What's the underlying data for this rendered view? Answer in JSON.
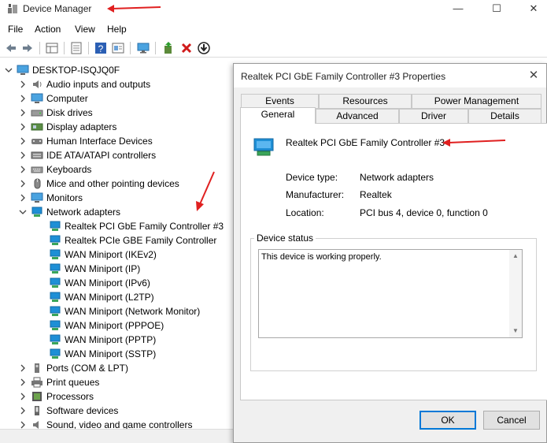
{
  "window": {
    "title": "Device Manager",
    "controls": {
      "minimize": "—",
      "maximize": "☐",
      "close": "✕"
    }
  },
  "menu": [
    "File",
    "Action",
    "View",
    "Help"
  ],
  "toolbar_icons": [
    "back-icon",
    "forward-icon",
    "properties-grid-icon",
    "show-hidden-icon",
    "help-icon",
    "view-icon",
    "monitor-icon",
    "update-driver-icon",
    "uninstall-icon",
    "download-icon"
  ],
  "tree": {
    "root": "DESKTOP-ISQJQ0F",
    "categories": [
      {
        "label": "Audio inputs and outputs",
        "icon": "audio-icon"
      },
      {
        "label": "Computer",
        "icon": "computer-icon"
      },
      {
        "label": "Disk drives",
        "icon": "disk-icon"
      },
      {
        "label": "Display adapters",
        "icon": "display-icon"
      },
      {
        "label": "Human Interface Devices",
        "icon": "hid-icon"
      },
      {
        "label": "IDE ATA/ATAPI controllers",
        "icon": "ide-icon"
      },
      {
        "label": "Keyboards",
        "icon": "keyboard-icon"
      },
      {
        "label": "Mice and other pointing devices",
        "icon": "mouse-icon"
      },
      {
        "label": "Monitors",
        "icon": "monitor-icon"
      },
      {
        "label": "Network adapters",
        "icon": "network-icon",
        "expanded": true
      }
    ],
    "network_children": [
      "Realtek PCI GbE Family Controller #3",
      "Realtek PCIe GBE Family Controller",
      "WAN Miniport (IKEv2)",
      "WAN Miniport (IP)",
      "WAN Miniport (IPv6)",
      "WAN Miniport (L2TP)",
      "WAN Miniport (Network Monitor)",
      "WAN Miniport (PPPOE)",
      "WAN Miniport (PPTP)",
      "WAN Miniport (SSTP)"
    ],
    "after": [
      {
        "label": "Ports (COM & LPT)",
        "icon": "port-icon"
      },
      {
        "label": "Print queues",
        "icon": "printer-icon"
      },
      {
        "label": "Processors",
        "icon": "processor-icon"
      },
      {
        "label": "Software devices",
        "icon": "software-icon"
      },
      {
        "label": "Sound, video and game controllers",
        "icon": "sound-icon"
      }
    ]
  },
  "dialog": {
    "title": "Realtek PCI GbE Family Controller #3 Properties",
    "close": "✕",
    "tabs_row1": [
      "Events",
      "Resources",
      "Power Management"
    ],
    "tabs_row2": [
      "General",
      "Advanced",
      "Driver",
      "Details"
    ],
    "active_tab": "General",
    "device_name": "Realtek PCI GbE Family Controller #3",
    "properties": [
      {
        "label": "Device type:",
        "value": "Network adapters"
      },
      {
        "label": "Manufacturer:",
        "value": "Realtek"
      },
      {
        "label": "Location:",
        "value": "PCI bus 4, device 0, function 0"
      }
    ],
    "status_group": "Device status",
    "status_text": "This device is working properly.",
    "ok": "OK",
    "cancel": "Cancel"
  },
  "colors": {
    "accent": "#0078d7",
    "annotation_arrow": "#e02020",
    "network_icon": "#1e8fd6"
  }
}
